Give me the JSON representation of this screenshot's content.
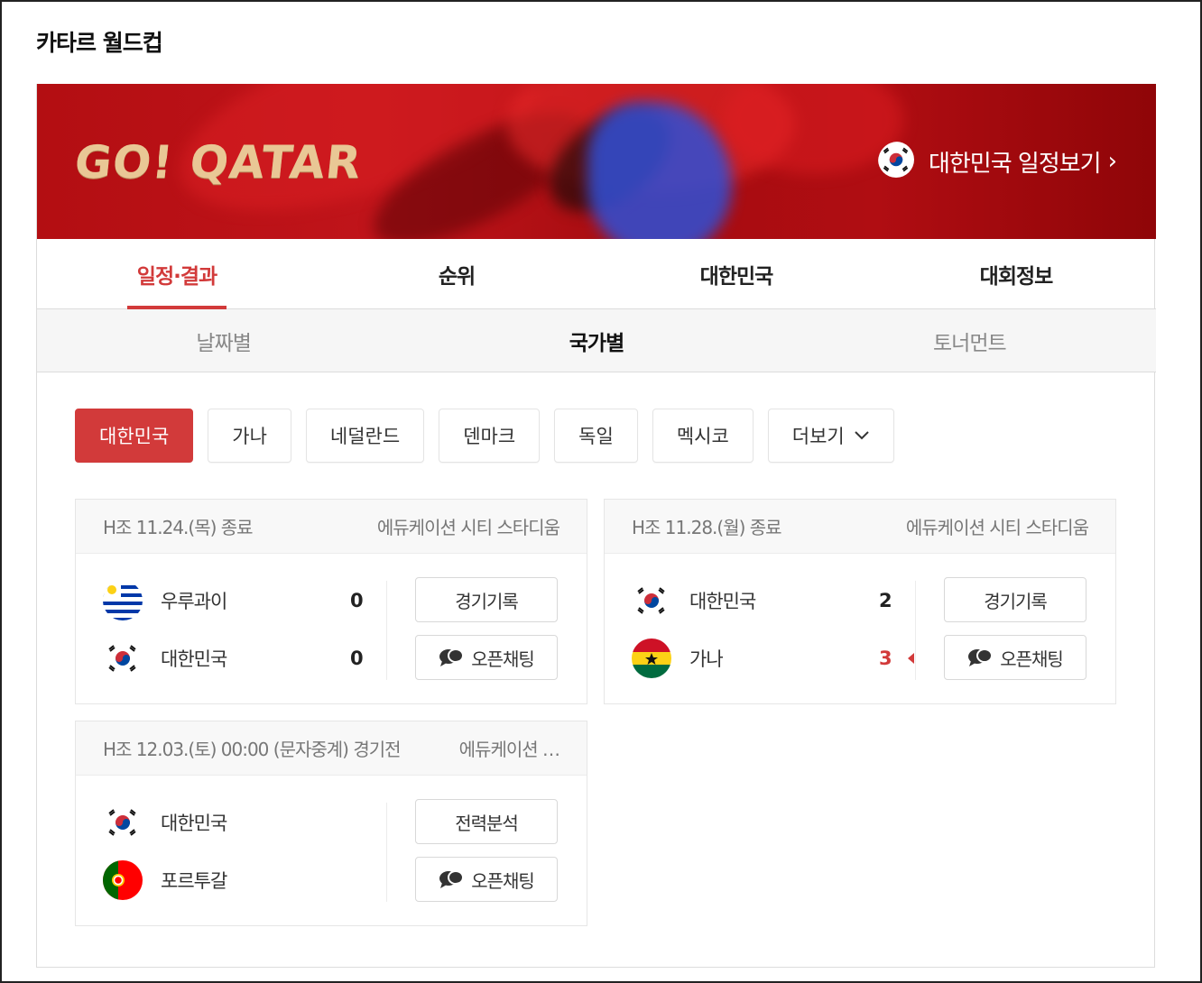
{
  "page": {
    "title": "카타르 월드컵"
  },
  "banner": {
    "logo_text": "GO! QATAR",
    "link_label": "대한민국 일정보기",
    "link_chevron": "›"
  },
  "tabs": [
    {
      "label": "일정·결과",
      "active": true
    },
    {
      "label": "순위",
      "active": false
    },
    {
      "label": "대한민국",
      "active": false
    },
    {
      "label": "대회정보",
      "active": false
    }
  ],
  "subtabs": [
    {
      "label": "날짜별",
      "active": false
    },
    {
      "label": "국가별",
      "active": true
    },
    {
      "label": "토너먼트",
      "active": false
    }
  ],
  "countries": [
    {
      "label": "대한민국",
      "active": true
    },
    {
      "label": "가나",
      "active": false
    },
    {
      "label": "네덜란드",
      "active": false
    },
    {
      "label": "덴마크",
      "active": false
    },
    {
      "label": "독일",
      "active": false
    },
    {
      "label": "멕시코",
      "active": false
    },
    {
      "label": "더보기",
      "active": false
    }
  ],
  "matches": [
    {
      "info": "H조 11.24.(목) 종료",
      "venue": "에듀케이션 시티 스타디움",
      "teams": [
        {
          "name": "우루과이",
          "flag": "uruguay-flag-icon",
          "score": "0"
        },
        {
          "name": "대한민국",
          "flag": "korea-flag-icon",
          "score": "0"
        }
      ],
      "buttons": [
        {
          "label": "경기기록"
        },
        {
          "label": "오픈채팅"
        }
      ]
    },
    {
      "info": "H조 11.28.(월) 종료",
      "venue": "에듀케이션 시티 스타디움",
      "teams": [
        {
          "name": "대한민국",
          "flag": "korea-flag-icon",
          "score": "2"
        },
        {
          "name": "가나",
          "flag": "ghana-flag-icon",
          "score": "3",
          "winner": true
        }
      ],
      "buttons": [
        {
          "label": "경기기록"
        },
        {
          "label": "오픈채팅"
        }
      ]
    },
    {
      "info": "H조 12.03.(토) 00:00 (문자중계) 경기전",
      "venue": "에듀케이션 …",
      "teams": [
        {
          "name": "대한민국",
          "flag": "korea-flag-icon"
        },
        {
          "name": "포르투갈",
          "flag": "portugal-flag-icon"
        }
      ],
      "buttons": [
        {
          "label": "전력분석"
        },
        {
          "label": "오픈채팅"
        }
      ]
    }
  ],
  "colors": {
    "accent": "#d23a3a",
    "banner": "#b30e12",
    "logo": "#e9c795"
  }
}
